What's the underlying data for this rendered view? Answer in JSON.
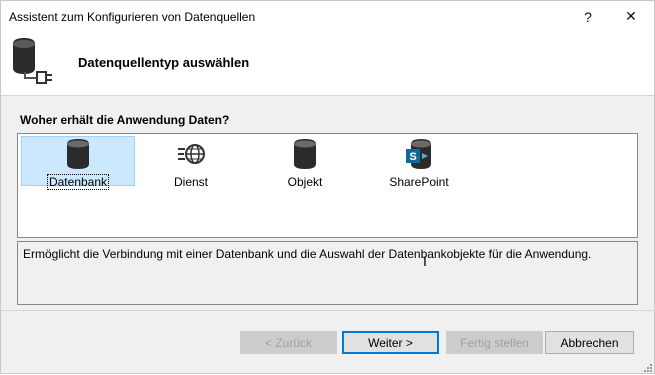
{
  "window": {
    "title": "Assistent zum Konfigurieren von Datenquellen",
    "help_label": "?",
    "close_label": "✕"
  },
  "header": {
    "title": "Datenquellentyp auswählen",
    "icon": "database-plug-icon"
  },
  "question": "Woher erhält die Anwendung Daten?",
  "source_types": [
    {
      "label": "Datenbank",
      "icon": "database-icon",
      "selected": true
    },
    {
      "label": "Dienst",
      "icon": "web-service-icon",
      "selected": false
    },
    {
      "label": "Objekt",
      "icon": "object-icon",
      "selected": false
    },
    {
      "label": "SharePoint",
      "icon": "sharepoint-icon",
      "selected": false
    }
  ],
  "description": "Ermöglicht die Verbindung mit einer Datenbank und die Auswahl der Datenbankobjekte für die Anwendung.",
  "buttons": {
    "back": "< Zurück",
    "next": "Weiter >",
    "finish": "Fertig stellen",
    "cancel": "Abbrechen"
  },
  "colors": {
    "selection": "#cce8ff",
    "accent": "#0078d7",
    "sharepoint": "#0b6a9a"
  }
}
